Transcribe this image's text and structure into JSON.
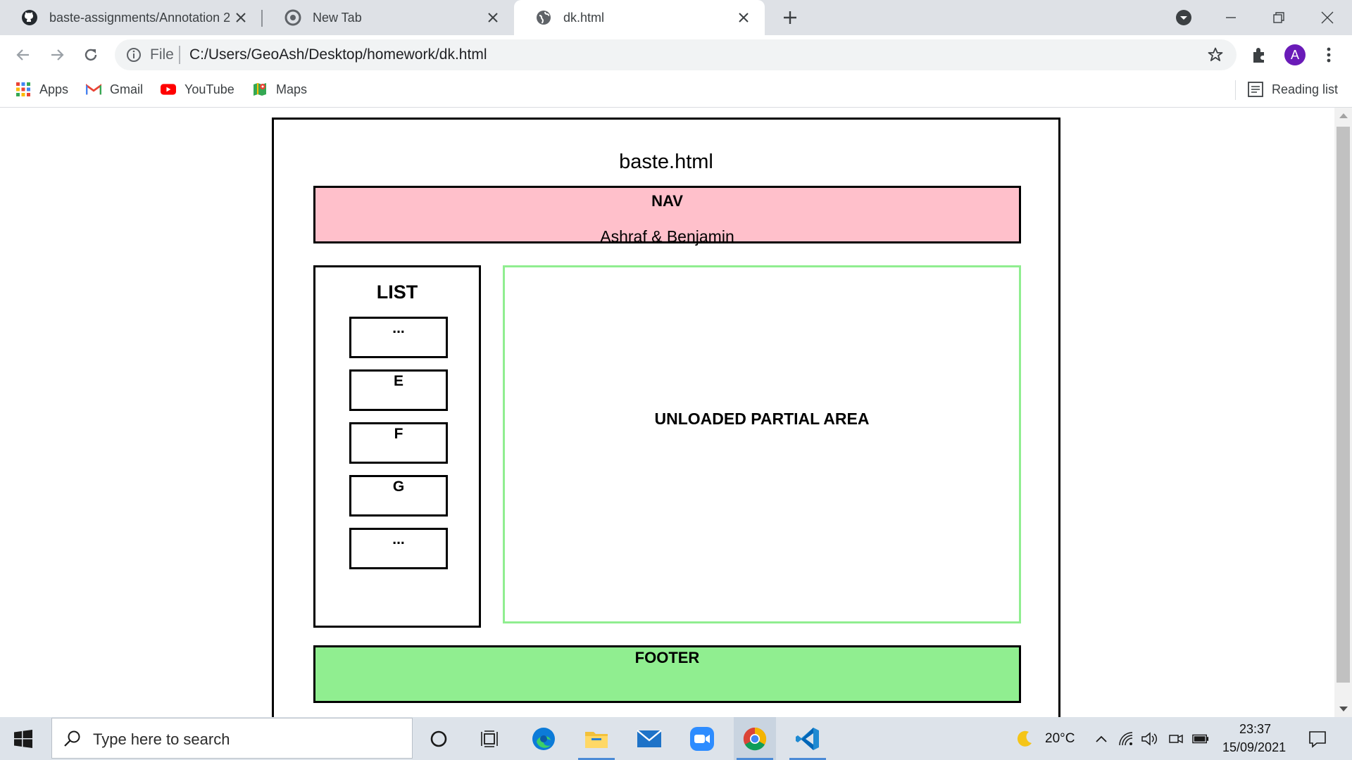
{
  "tabs": [
    {
      "title": "baste-assignments/Annotation 2(",
      "favicon": "github-icon",
      "active": false
    },
    {
      "title": "New Tab",
      "favicon": "chrome-icon",
      "active": false
    },
    {
      "title": "dk.html",
      "favicon": "globe-icon",
      "active": true
    }
  ],
  "address_bar": {
    "scheme_label": "File",
    "url": "C:/Users/GeoAsh/Desktop/homework/dk.html"
  },
  "profile": {
    "initial": "A",
    "color": "#6a1bb8"
  },
  "bookmarks": [
    {
      "label": "Apps",
      "icon": "apps-grid-icon"
    },
    {
      "label": "Gmail",
      "icon": "gmail-icon"
    },
    {
      "label": "YouTube",
      "icon": "youtube-icon"
    },
    {
      "label": "Maps",
      "icon": "maps-icon"
    }
  ],
  "reading_list": {
    "label": "Reading list",
    "icon": "reading-list-icon"
  },
  "page": {
    "title": "baste.html",
    "nav": {
      "label": "NAV",
      "subtitle": "Ashraf & Benjamin",
      "color": "#ffc0cb"
    },
    "list": {
      "title": "LIST",
      "items": [
        "...",
        "E",
        "F",
        "G",
        "..."
      ]
    },
    "partial": {
      "label": "UNLOADED PARTIAL AREA",
      "border_color": "#90ee90"
    },
    "footer": {
      "label": "FOOTER",
      "color": "#90ee90"
    }
  },
  "taskbar": {
    "search_placeholder": "Type here to search",
    "apps": [
      "cortana-icon",
      "task-view-icon",
      "edge-icon",
      "file-explorer-icon",
      "mail-icon",
      "zoom-icon",
      "chrome-icon",
      "vscode-icon"
    ],
    "weather": {
      "temp": "20°C",
      "icon": "moon-icon"
    },
    "time": "23:37",
    "date": "15/09/2021"
  }
}
